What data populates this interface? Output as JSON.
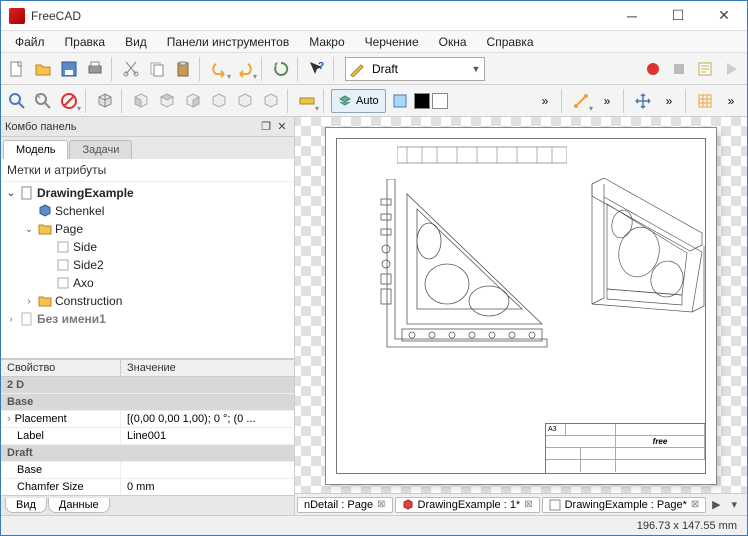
{
  "window": {
    "title": "FreeCAD"
  },
  "menu": [
    "Файл",
    "Правка",
    "Вид",
    "Панели инструментов",
    "Макро",
    "Черчение",
    "Окна",
    "Справка"
  ],
  "workbench": {
    "label": "Draft"
  },
  "auto_button": "Auto",
  "combo_panel": {
    "title": "Комбо панель",
    "tabs": [
      "Модель",
      "Задачи"
    ],
    "tree_header": "Метки и атрибуты",
    "tree": [
      {
        "label": "DrawingExample",
        "indent": 0,
        "toggle": "v",
        "icon": "doc",
        "bold": true
      },
      {
        "label": "Schenkel",
        "indent": 1,
        "toggle": "",
        "icon": "cube"
      },
      {
        "label": "Page",
        "indent": 1,
        "toggle": "v",
        "icon": "folder"
      },
      {
        "label": "Side",
        "indent": 2,
        "toggle": "",
        "icon": "box"
      },
      {
        "label": "Side2",
        "indent": 2,
        "toggle": "",
        "icon": "box"
      },
      {
        "label": "Axo",
        "indent": 2,
        "toggle": "",
        "icon": "box"
      },
      {
        "label": "Construction",
        "indent": 1,
        "toggle": ">",
        "icon": "folder"
      },
      {
        "label": "Без имени1",
        "indent": 0,
        "toggle": ">",
        "icon": "doc",
        "bold": true,
        "cut": true
      }
    ],
    "prop_header": {
      "c1": "Свойство",
      "c2": "Значение"
    },
    "props": [
      {
        "type": "group",
        "label": "2 D"
      },
      {
        "type": "group",
        "label": "Base"
      },
      {
        "c1": "Placement",
        "c2": "[(0,00 0,00 1,00); 0 °; (0 ...",
        "expand": ">"
      },
      {
        "c1": "Label",
        "c2": "Line001"
      },
      {
        "type": "group",
        "label": "Draft"
      },
      {
        "c1": "Base",
        "c2": ""
      },
      {
        "c1": "Chamfer Size",
        "c2": "0 mm",
        "cut": true
      }
    ],
    "bottom_tabs": [
      "Вид",
      "Данные"
    ]
  },
  "title_block": {
    "size": "A3",
    "logo": "free"
  },
  "doc_tabs": [
    {
      "label": "nDetail : Page",
      "icon": "page"
    },
    {
      "label": "DrawingExample : 1*",
      "icon": "3d"
    },
    {
      "label": "DrawingExample : Page*",
      "icon": "page"
    }
  ],
  "status": {
    "coords": "196.73 x 147.55 mm"
  }
}
